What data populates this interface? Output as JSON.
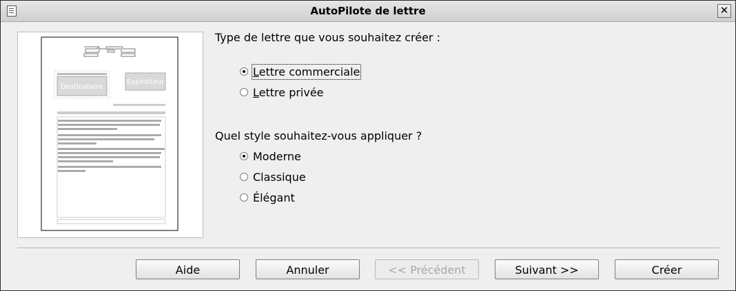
{
  "window": {
    "title": "AutoPilote de lettre",
    "close_label": "✕"
  },
  "preview": {
    "recipient_label": "Destinataire",
    "sender_label": "Expéditeur"
  },
  "letter_type": {
    "heading": "Type de lettre que vous souhaitez créer :",
    "options": [
      {
        "label": "Lettre commerciale",
        "mnemonic": "L",
        "rest": "ettre commerciale",
        "checked": true
      },
      {
        "label": "Lettre privée",
        "mnemonic": "L",
        "rest": "ettre privée",
        "checked": false
      }
    ]
  },
  "style": {
    "heading": "Quel style souhaitez-vous appliquer ?",
    "options": [
      {
        "label": "Moderne",
        "checked": true
      },
      {
        "label": "Classique",
        "checked": false
      },
      {
        "label": "Élégant",
        "checked": false
      }
    ]
  },
  "buttons": {
    "help": "Aide",
    "cancel": "Annuler",
    "previous": "<< Précédent",
    "next": "Suivant >>",
    "create": "Créer"
  }
}
